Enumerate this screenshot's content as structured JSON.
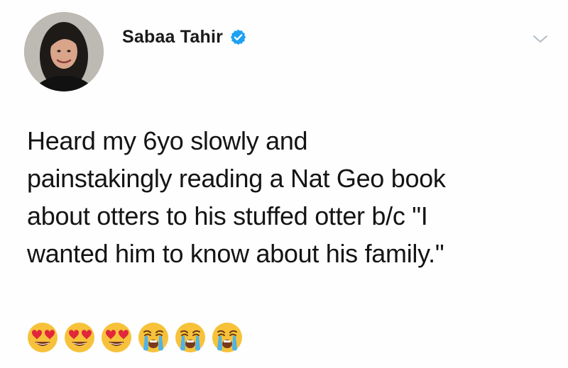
{
  "tweet": {
    "author_name": "Sabaa Tahir",
    "verified": true,
    "avatar_icon": "user-photo-icon",
    "menu_icon": "chevron-down-icon",
    "text_lines": [
      "Heard my 6yo slowly and",
      "painstakingly reading a Nat Geo book",
      "about otters to his stuffed otter b/c \"I",
      "wanted him to know about his family.\""
    ],
    "emojis": [
      "heart-eyes-emoji-icon",
      "heart-eyes-emoji-icon",
      "heart-eyes-emoji-icon",
      "loudly-crying-emoji-icon",
      "loudly-crying-emoji-icon",
      "loudly-crying-emoji-icon"
    ]
  },
  "colors": {
    "verified_badge": "#1DA1F2",
    "text": "#141414",
    "emoji_face": "#F7C23A"
  }
}
